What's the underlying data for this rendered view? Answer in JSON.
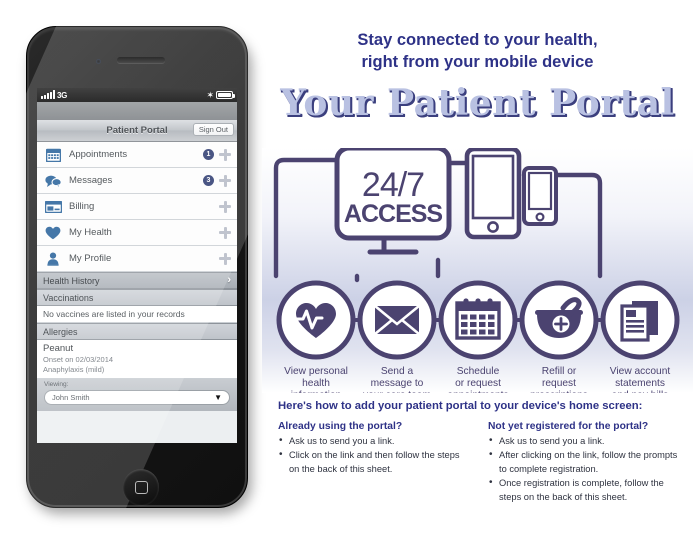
{
  "phone": {
    "status_bar": {
      "signal_icon": "signal-bars-icon",
      "network": "3G",
      "bluetooth_icon": "bluetooth-icon",
      "battery_icon": "battery-icon"
    },
    "nav": {
      "title": "Patient Portal",
      "sign_out": "Sign Out"
    },
    "menu": [
      {
        "icon": "calendar-icon",
        "label": "Appointments",
        "badge": "1",
        "action": "plus-icon"
      },
      {
        "icon": "messages-bubble-icon",
        "label": "Messages",
        "badge": "3",
        "action": "plus-icon"
      },
      {
        "icon": "credit-card-icon",
        "label": "Billing",
        "badge": "",
        "action": "plus-icon"
      },
      {
        "icon": "heart-icon",
        "label": "My Health",
        "badge": "",
        "action": "plus-icon"
      },
      {
        "icon": "person-icon",
        "label": "My Profile",
        "badge": "",
        "action": "plus-icon"
      }
    ],
    "health_history": {
      "label": "Health History",
      "chevron": "chevron-right-icon"
    },
    "vaccinations": {
      "heading": "Vaccinations",
      "body": "No vaccines are listed in your records"
    },
    "allergies": {
      "heading": "Allergies",
      "name": "Peanut",
      "onset": "Onset on 02/03/2014",
      "reaction": "Anaphylaxis (mild)"
    },
    "viewing": {
      "label": "Viewing:",
      "value": "John Smith",
      "caret": "chevron-down-icon"
    }
  },
  "header": {
    "tagline_line1": "Stay connected to your health,",
    "tagline_line2": "right from your mobile device",
    "title": "Your Patient Portal"
  },
  "diagram": {
    "screen_text_top": "24/7",
    "screen_text_bottom": "ACCESS",
    "devices": [
      {
        "name": "desktop-monitor-icon"
      },
      {
        "name": "tablet-icon"
      },
      {
        "name": "smartphone-icon"
      }
    ],
    "features": [
      {
        "icon": "heartbeat-icon",
        "lines": [
          "View personal",
          "health",
          "information"
        ]
      },
      {
        "icon": "envelope-icon",
        "lines": [
          "Send a",
          "message to",
          "your care team"
        ]
      },
      {
        "icon": "calendar-icon",
        "lines": [
          "Schedule",
          "or request",
          "appointments"
        ]
      },
      {
        "icon": "mortar-pestle-icon",
        "lines": [
          "Refill or",
          "request",
          "prescriptions"
        ]
      },
      {
        "icon": "documents-icon",
        "lines": [
          "View account",
          "statements",
          "and pay bills"
        ]
      }
    ]
  },
  "bottom": {
    "heading": "Here's how to add your patient portal to your device's home screen:",
    "columns": [
      {
        "title": "Already using the portal?",
        "items": [
          "Ask us to send you a link.",
          "Click on the link and then follow the steps on the back of this sheet."
        ]
      },
      {
        "title": "Not yet registered for the portal?",
        "items": [
          "Ask us to send you a link.",
          "After clicking on the link, follow the prompts to complete registration.",
          "Once registration is complete, follow the steps on the back of this sheet."
        ]
      }
    ]
  },
  "colors": {
    "brand_navy": "#2e3287",
    "diagram_purple": "#4b4370",
    "title_fill": "#b9c1e2",
    "badge": "#26346b",
    "ios_icon_blue": "#1f5c96"
  }
}
